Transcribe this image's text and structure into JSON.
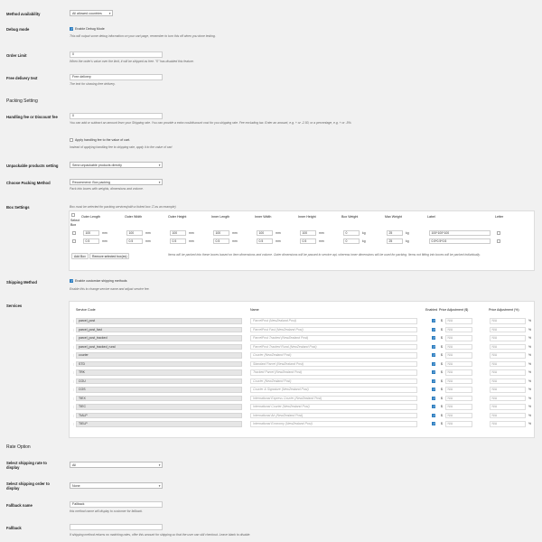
{
  "rows": {
    "method_availability": {
      "label": "Method availability",
      "value": "All allowed countries"
    },
    "debug_mode": {
      "label": "Debug mode",
      "checkbox": "Enable Debug Mode",
      "checked": true,
      "desc": "This will output some debug information on your cart page, remember to turn this off when you done testing."
    },
    "order_limit": {
      "label": "Order Limit",
      "value": "0",
      "desc": "When the order's value over the limit, it will be shipped as free. \"0\" has disabled this feature."
    },
    "free_delivery": {
      "label": "Free delivery text",
      "value": "Free delivery",
      "desc": "The text for showing free delivery."
    },
    "packing_setting": {
      "title": "Packing Setting"
    },
    "handling_fee": {
      "label": "Handling fee or Discount fee",
      "value": "0",
      "desc": "You can add or subtract an amount from your Shipping rate. You can provide a extra cost/discount cost for you shipping rate. Fee excluding tax. Enter an amount, e.g. + or -2.50, or a percentage, e.g. + or -5%.",
      "checkbox": "Apply handling fee to the value of cart.",
      "checked": false,
      "desc2": "Instead of applying handling fee to shipping rate, apply it to the value of cart"
    },
    "unpackable": {
      "label": "Unpackable products setting",
      "value": "Send unpackable products directly"
    },
    "packing_method": {
      "label": "Choose Packing Method",
      "value": "Recommend: Box packing",
      "desc": "Pack into boxes with weights, dimensions and volume."
    },
    "box_settings": {
      "label": "Box Settings",
      "desc": "Box must be selected for packing services(with a ticked box ☑ as an example)",
      "headers": [
        "Select Box",
        "Outer Length",
        "Outer Width",
        "Outer Height",
        "Inner Length",
        "Inner Width",
        "Inner Height",
        "Box Weight",
        "Max Weight",
        "Label",
        "Letter"
      ],
      "unit_len": "mm",
      "unit_wt": "kg",
      "boxes": [
        {
          "ol": "100",
          "ow": "100",
          "oh": "100",
          "il": "100",
          "iw": "100",
          "ih": "100",
          "bw": "0",
          "mw": "25",
          "label": "100*100*100"
        },
        {
          "ol": "0.5",
          "ow": "0.5",
          "oh": "0.5",
          "il": "0.5",
          "iw": "0.5",
          "ih": "0.5",
          "bw": "0",
          "mw": "25",
          "label": "0.5*0.5*0.5"
        }
      ],
      "add_btn": "Add Box",
      "remove_btn": "Remove selected box(es)",
      "note": "Items will be packed into these boxes based on item dimensions and volume. Outer dimensions will be passed to service api, whereas inner dimensions will be used for packing. Items not fitting into boxes will be packed individually."
    },
    "shipping_method": {
      "label": "Shipping Method",
      "checkbox": "Enable customize shipping methods",
      "checked": true,
      "desc": "Enable this to change service name and adjust service fee."
    },
    "services": {
      "label": "Services",
      "headers": {
        "code": "Service Code",
        "name": "Name",
        "enabled": "Enabled",
        "price_adj": "Price Adjustment ($)",
        "price_adj_pct": "Price Adjustment (%)"
      },
      "currency": "$",
      "percent": "%",
      "na": "N/A",
      "items": [
        {
          "code": "parcel_post",
          "name": "ParcelPost (NewZealand Post)"
        },
        {
          "code": "parcel_post_fast",
          "name": "ParcelPost Fast (NewZealand Post)"
        },
        {
          "code": "parcel_post_tracked",
          "name": "ParcelPost Tracked (NewZealand Post)"
        },
        {
          "code": "parcel_post_tracked_rural",
          "name": "ParcelPost Tracked Rural (NewZealand Post)"
        },
        {
          "code": "courier",
          "name": "Courier (NewZealand Post)"
        },
        {
          "code": "STD",
          "name": "Standard Parcel (NewZealand Post)"
        },
        {
          "code": "TRK",
          "name": "Tracked Parcel (NewZealand Post)"
        },
        {
          "code": "COU",
          "name": "Courier (NewZealand Post)"
        },
        {
          "code": "COS",
          "name": "Courier & Signature (NewZealand Post)"
        },
        {
          "code": "TIEX",
          "name": "International Express Courier (NewZealand Post)"
        },
        {
          "code": "TIEC",
          "name": "International Courier (NewZealand Post)"
        },
        {
          "code": "TIALP",
          "name": "International Air (NewZealand Post)"
        },
        {
          "code": "TIELP",
          "name": "International Economy (NewZealand Post)"
        }
      ]
    },
    "rate_option": {
      "title": "Rate Option"
    },
    "select_rate": {
      "label": "Select shipping rate to display",
      "value": "All"
    },
    "select_order": {
      "label": "Select shipping order to display",
      "value": "None"
    },
    "fallback_name": {
      "label": "Fallback name",
      "value": "Fallback",
      "desc": "this method name will display to customer for fallback."
    },
    "fallback": {
      "label": "Fallback",
      "value": "",
      "desc": "If shipping method returns no matching rates, offer this amount for shipping so that the user can still checkout. Leave blank to disable."
    }
  }
}
